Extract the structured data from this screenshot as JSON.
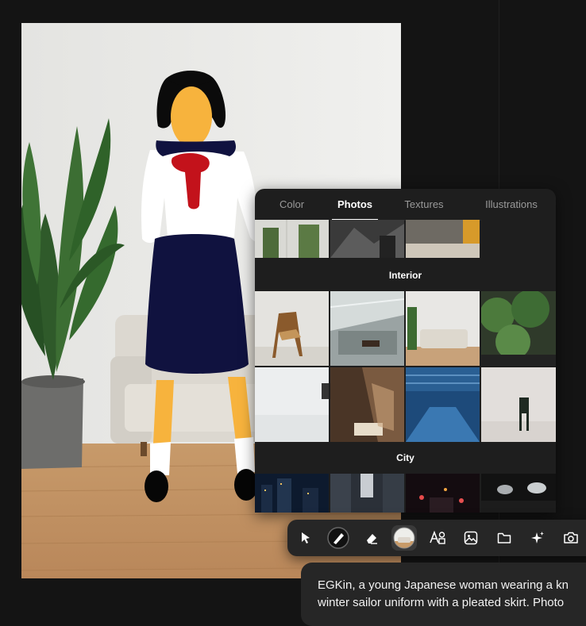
{
  "panel": {
    "tabs": [
      {
        "label": "Color",
        "active": false
      },
      {
        "label": "Photos",
        "active": true
      },
      {
        "label": "Textures",
        "active": false
      },
      {
        "label": "Illustrations",
        "active": false
      }
    ],
    "sections": [
      {
        "title": "Interior"
      },
      {
        "title": "City"
      }
    ]
  },
  "toolbar": {
    "tools": [
      {
        "icon": "pointer-icon",
        "selected": false
      },
      {
        "icon": "brush-icon",
        "selected": false
      },
      {
        "icon": "eraser-icon",
        "selected": false
      },
      {
        "icon": "background-thumbnail",
        "selected": true
      },
      {
        "icon": "text-shapes-icon",
        "selected": false
      },
      {
        "icon": "image-icon",
        "selected": false
      },
      {
        "icon": "folder-icon",
        "selected": false
      },
      {
        "icon": "sparkles-icon",
        "selected": false
      },
      {
        "icon": "camera-plus-icon",
        "selected": false
      }
    ]
  },
  "prompt": {
    "line1": "EGKin, a young Japanese woman wearing a kn",
    "line2": "winter sailor uniform with a pleated skirt. Photo"
  },
  "colors": {
    "app_bg": "#141414",
    "panel_bg": "#1e1e1e",
    "toolbar_bg": "#262626",
    "uniform_navy": "#10123f",
    "scarf_red": "#c3121b",
    "skin": "#f7b33d"
  }
}
